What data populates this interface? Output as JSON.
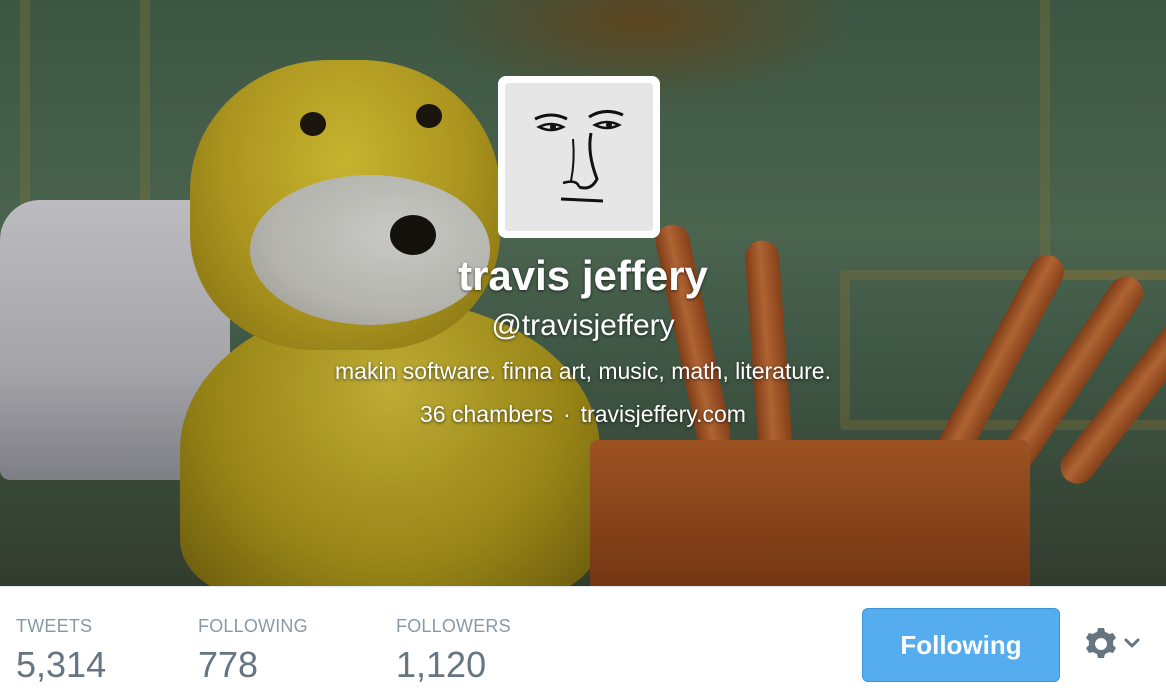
{
  "profile": {
    "name": "travis jeffery",
    "handle": "@travisjeffery",
    "bio": "makin software. finna art, music, math, literature.",
    "location": "36 chambers",
    "separator": "·",
    "website": "travisjeffery.com"
  },
  "stats": [
    {
      "label": "TWEETS",
      "value": "5,314"
    },
    {
      "label": "FOLLOWING",
      "value": "778"
    },
    {
      "label": "FOLLOWERS",
      "value": "1,120"
    }
  ],
  "actions": {
    "follow_label": "Following",
    "gear_icon": "gear-icon",
    "caret_icon": "chevron-down-icon"
  },
  "colors": {
    "accent": "#55acee",
    "stat_label": "#8899a6",
    "stat_value": "#66757f"
  }
}
